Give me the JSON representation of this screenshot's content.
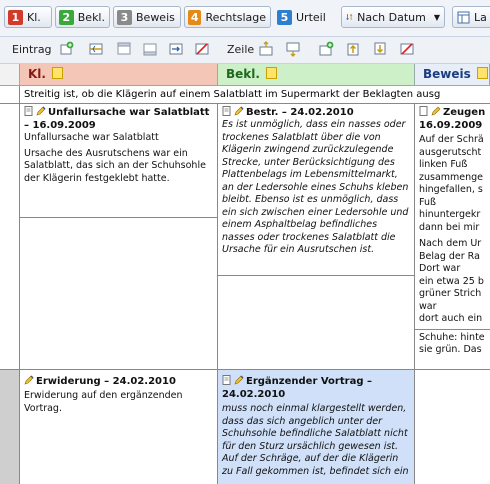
{
  "colors": {
    "kl": "#f3c6b8",
    "bekl": "#cdf0c8",
    "beweis": "#e8eef8",
    "highlight": "#cfe0f8"
  },
  "tabs": [
    {
      "num": "1",
      "label": "Kl.",
      "color": "#d23b2a",
      "active": false
    },
    {
      "num": "2",
      "label": "Bekl.",
      "color": "#3aa83a",
      "active": false
    },
    {
      "num": "3",
      "label": "Beweis",
      "color": "#8a8a8a",
      "active": false
    },
    {
      "num": "4",
      "label": "Rechtslage",
      "color": "#e58a16",
      "active": false
    },
    {
      "num": "5",
      "label": "Urteil",
      "color": "#2f7fd0",
      "active": true
    },
    {
      "label": "Nach Datum",
      "icon": "sort-icon"
    },
    {
      "label": "La",
      "icon": "layout-icon"
    }
  ],
  "toolbar": {
    "entry_label": "Eintrag",
    "row_label": "Zeile"
  },
  "columns": [
    {
      "label": "Kl."
    },
    {
      "label": "Bekl."
    },
    {
      "label": "Beweis"
    }
  ],
  "dispute_text": "Streitig ist, ob die Klägerin auf einem Salatblatt im Supermarkt der Beklagten ausg",
  "row1": {
    "kl": {
      "title": "Unfallursache war Salatblatt – 16.09.2009",
      "p1": "Unfallursache war Salatblatt",
      "p2": "Ursache des Ausrutschens war ein Salatblatt, das sich an der Schuhsohle der Klägerin festgeklebt hatte."
    },
    "bekl": {
      "title": "Bestr. – 24.02.2010",
      "p1": "Es ist unmöglich, dass ein nasses oder trockenes Salatblatt über die von Klägerin zwingend zurückzulegende Strecke, unter Berücksichtigung des Plattenbelags im Lebensmittelmarkt, an der Ledersohle eines Schuhs kleben bleibt. Ebenso ist es unmöglich, dass ein sich zwischen einer Ledersohle und einem Asphaltbelag befindliches nasses oder trockenes Salatblatt die Ursache für ein Ausrutschen ist."
    },
    "beweis": {
      "title": "Zeugen",
      "date": "16.09.2009",
      "lines": [
        "Auf der Schrä",
        "ausgerutscht",
        "linken Fuß",
        "zusammenge",
        "hingefallen, s",
        "Fuß",
        "hinuntergekr",
        "dann bei mir"
      ],
      "lines2": [
        "Nach dem Ur",
        "Belag der Ra",
        "Dort war",
        "ein etwa 25 b",
        "grüner Strich",
        "war",
        "dort auch ein"
      ],
      "lines3": [
        "Schuhe: hinte",
        "sie grün. Das"
      ]
    }
  },
  "row2": {
    "kl": {
      "title": "Erwiderung – 24.02.2010",
      "p1": "Erwiderung auf den ergänzenden Vortrag."
    },
    "bekl": {
      "title": "Ergänzender Vortrag – 24.02.2010",
      "p1": "muss noch einmal klargestellt werden, dass das sich angeblich unter der Schuhsohle befindliche Salatblatt nicht für den Sturz ursächlich gewesen ist. Auf der Schräge, auf der die Klägerin zu Fall gekommen ist, befindet sich ein"
    }
  }
}
